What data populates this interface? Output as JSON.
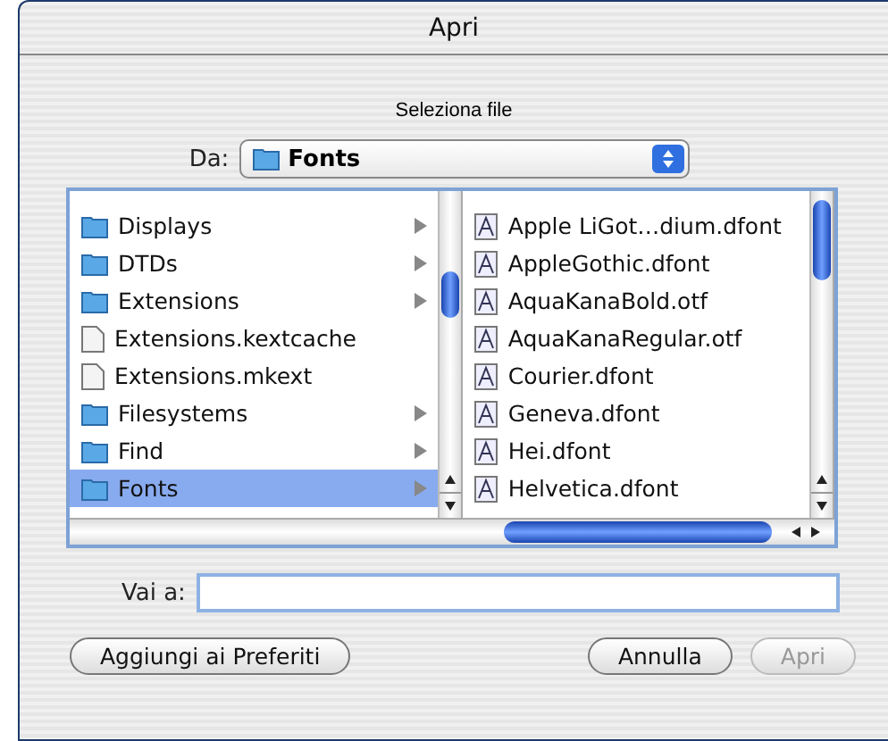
{
  "window": {
    "title": "Apri"
  },
  "prompt": "Seleziona file",
  "location": {
    "label": "Da:",
    "value": "Fonts"
  },
  "browser": {
    "columns": [
      {
        "items": [
          {
            "name": "Displays",
            "kind": "folder",
            "selected": false
          },
          {
            "name": "DTDs",
            "kind": "folder",
            "selected": false
          },
          {
            "name": "Extensions",
            "kind": "folder",
            "selected": false
          },
          {
            "name": "Extensions.kextcache",
            "kind": "file",
            "selected": false
          },
          {
            "name": "Extensions.mkext",
            "kind": "file",
            "selected": false
          },
          {
            "name": "Filesystems",
            "kind": "folder",
            "selected": false
          },
          {
            "name": "Find",
            "kind": "folder",
            "selected": false
          },
          {
            "name": "Fonts",
            "kind": "folder",
            "selected": true
          }
        ]
      },
      {
        "items": [
          {
            "name": "Apple LiGot…dium.dfont",
            "kind": "font",
            "selected": false
          },
          {
            "name": "AppleGothic.dfont",
            "kind": "font",
            "selected": false
          },
          {
            "name": "AquaKanaBold.otf",
            "kind": "font",
            "selected": false
          },
          {
            "name": "AquaKanaRegular.otf",
            "kind": "font",
            "selected": false
          },
          {
            "name": "Courier.dfont",
            "kind": "font",
            "selected": false
          },
          {
            "name": "Geneva.dfont",
            "kind": "font",
            "selected": false
          },
          {
            "name": "Hei.dfont",
            "kind": "font",
            "selected": false
          },
          {
            "name": "Helvetica.dfont",
            "kind": "font",
            "selected": false
          }
        ]
      }
    ]
  },
  "goto": {
    "label": "Vai a:"
  },
  "buttons": [
    {
      "label": "Aggiungi ai Preferiti",
      "kind": "left",
      "disabled": false
    },
    {
      "label": "Annulla",
      "kind": "right",
      "disabled": false
    },
    {
      "label": "Apri",
      "kind": "right",
      "disabled": true
    }
  ]
}
